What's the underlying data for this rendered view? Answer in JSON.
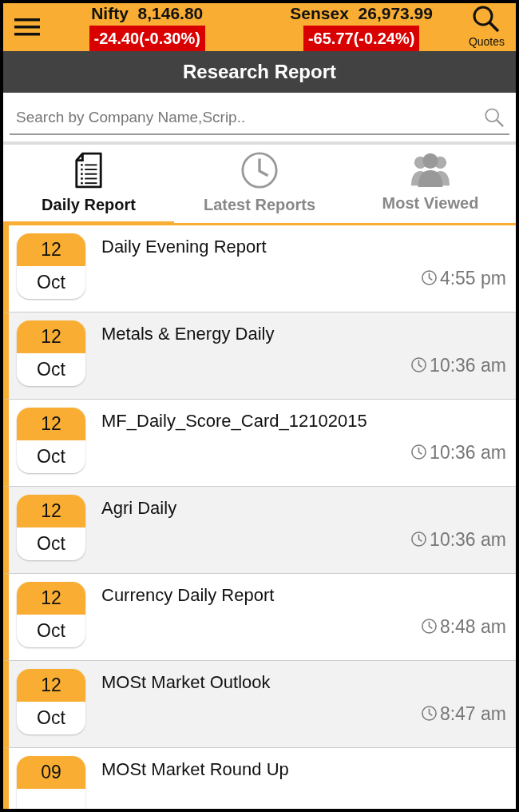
{
  "header": {
    "indices": [
      {
        "name": "Nifty",
        "value": "8,146.80",
        "change": "-24.40(-0.30%)"
      },
      {
        "name": "Sensex",
        "value": "26,973.99",
        "change": "-65.77(-0.24%)"
      }
    ],
    "quotes_label": "Quotes"
  },
  "title": "Research Report",
  "search": {
    "placeholder": "Search by Company Name,Scrip.."
  },
  "tabs": [
    {
      "label": "Daily Report",
      "kind": "document",
      "selected": true
    },
    {
      "label": "Latest Reports",
      "kind": "clock",
      "selected": false
    },
    {
      "label": "Most Viewed",
      "kind": "people",
      "selected": false
    }
  ],
  "reports": [
    {
      "day": "12",
      "month": "Oct",
      "title": "Daily Evening Report",
      "time": "4:55 pm"
    },
    {
      "day": "12",
      "month": "Oct",
      "title": "Metals & Energy Daily",
      "time": "10:36 am"
    },
    {
      "day": "12",
      "month": "Oct",
      "title": "MF_Daily_Score_Card_12102015",
      "time": "10:36 am"
    },
    {
      "day": "12",
      "month": "Oct",
      "title": "Agri Daily",
      "time": "10:36 am"
    },
    {
      "day": "12",
      "month": "Oct",
      "title": "Currency Daily Report",
      "time": "8:48 am"
    },
    {
      "day": "12",
      "month": "Oct",
      "title": "MOSt Market Outlook",
      "time": "8:47 am"
    },
    {
      "day": "09",
      "title": "MOSt Market Round Up"
    }
  ]
}
